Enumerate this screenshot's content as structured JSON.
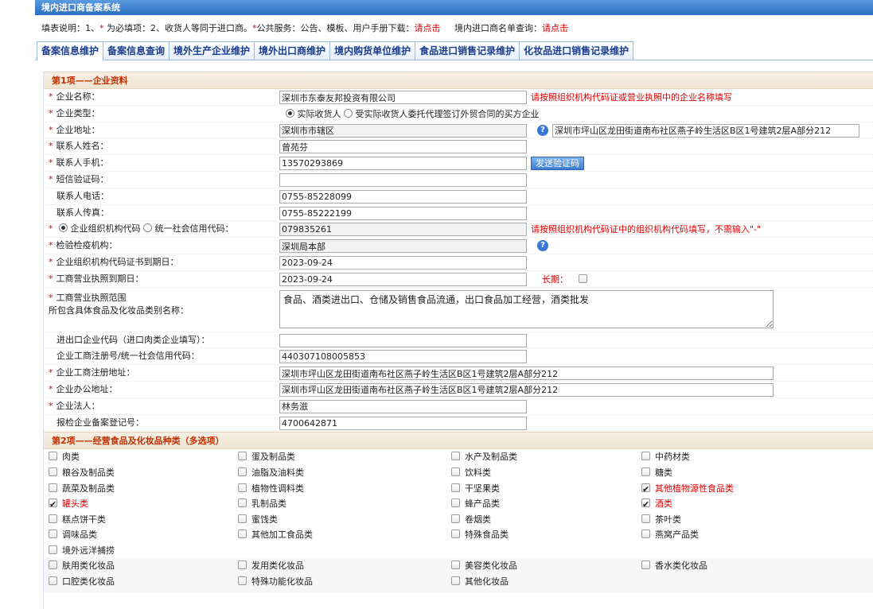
{
  "app": {
    "title": "境内进口商备案系统"
  },
  "notice": {
    "prefix": "填表说明：1、",
    "star": "*",
    "text1": " 为必填项：2、收货人等同于进口商。",
    "star2": "*",
    "text2": "公共服务：公告、模板、用户手册下载：",
    "link1": "请点击",
    "text3": "境内进口商名单查询：",
    "link2": "请点击"
  },
  "tabs": [
    "备案信息维护",
    "备案信息查询",
    "境外生产企业维护",
    "境外出口商维护",
    "境内购货单位维护",
    "食品进口销售记录维护",
    "化妆品进口销售记录维护"
  ],
  "section1": {
    "title": "第1项——企业资料"
  },
  "form": {
    "company_name": {
      "label": "企业名称：",
      "value": "深圳市东泰友邦投资有限公司",
      "hint": "请按照组织机构代码证或营业执照中的企业名称填写"
    },
    "company_type": {
      "label": "企业类型：",
      "opt1": "实际收货人",
      "opt2": "受实际收货人委托代理签订外贸合同的买方企业"
    },
    "address": {
      "label": "企业地址：",
      "district": "深圳市市辖区",
      "detail": "深圳市坪山区龙田街道南布社区燕子岭生活区B区1号建筑2层A部分212"
    },
    "contact_name": {
      "label": "联系人姓名：",
      "value": "曾苑芬"
    },
    "contact_mobile": {
      "label": "联系人手机：",
      "value": "13570293869",
      "button": "发送验证码"
    },
    "sms_code": {
      "label": "短信验证码：",
      "value": ""
    },
    "contact_phone": {
      "label": "联系人电话：",
      "value": "0755-85228099"
    },
    "contact_fax": {
      "label": "联系人传真：",
      "value": "0755-85222199"
    },
    "org_code": {
      "opt1": "企业组织机构代码",
      "opt2": "统一社会信用代码：",
      "value": "079835261",
      "hint": "请按照组织机构代码证中的组织机构代码填写，不需输入\"-\""
    },
    "inspection": {
      "label": "检验检疫机构：",
      "value": "深圳局本部"
    },
    "org_expiry": {
      "label": "企业组织机构代码证书到期日：",
      "value": "2023-09-24"
    },
    "license_expiry": {
      "label": "工商营业执照到期日：",
      "value": "2023-09-24",
      "long_term": "长期："
    },
    "scope": {
      "label1": "工商营业执照范围",
      "label2": "所包含具体食品及化妆品类别名称：",
      "value": "食品、酒类进出口、仓储及销售食品流通，出口食品加工经营，酒类批发"
    },
    "ie_code": {
      "label": "进出口企业代码（进口肉类企业填写）：",
      "value": ""
    },
    "reg_no": {
      "label": "企业工商注册号/统一社会信用代码：",
      "value": "440307108005853"
    },
    "reg_address": {
      "label": "企业工商注册地址：",
      "value": "深圳市坪山区龙田街道南布社区燕子岭生活区B区1号建筑2层A部分212"
    },
    "office_address": {
      "label": "企业办公地址：",
      "value": "深圳市坪山区龙田街道南布社区燕子岭生活区B区1号建筑2层A部分212"
    },
    "legal_person": {
      "label": "企业法人：",
      "value": "林务滋"
    },
    "filing_no": {
      "label": "报检企业备案登记号：",
      "value": "4700642871"
    }
  },
  "section2": {
    "title": "第2项——经营食品及化妆品种类（多选项）"
  },
  "categories": [
    {
      "label": "肉类",
      "checked": false
    },
    {
      "label": "蛋及制品类",
      "checked": false
    },
    {
      "label": "水产及制品类",
      "checked": false
    },
    {
      "label": "中药材类",
      "checked": false
    },
    {
      "label": "粮谷及制品类",
      "checked": false
    },
    {
      "label": "油脂及油料类",
      "checked": false
    },
    {
      "label": "饮料类",
      "checked": false
    },
    {
      "label": "糖类",
      "checked": false
    },
    {
      "label": "蔬菜及制品类",
      "checked": false
    },
    {
      "label": "植物性调料类",
      "checked": false
    },
    {
      "label": "干坚果类",
      "checked": false
    },
    {
      "label": "其他植物源性食品类",
      "checked": true
    },
    {
      "label": "罐头类",
      "checked": true
    },
    {
      "label": "乳制品类",
      "checked": false
    },
    {
      "label": "蜂产品类",
      "checked": false
    },
    {
      "label": "酒类",
      "checked": true
    },
    {
      "label": "糕点饼干类",
      "checked": false
    },
    {
      "label": "蜜饯类",
      "checked": false
    },
    {
      "label": "卷烟类",
      "checked": false
    },
    {
      "label": "茶叶类",
      "checked": false
    },
    {
      "label": "调味品类",
      "checked": false
    },
    {
      "label": "其他加工食品类",
      "checked": false
    },
    {
      "label": "特殊食品类",
      "checked": false
    },
    {
      "label": "燕窝产品类",
      "checked": false
    },
    {
      "label": "境外远洋捕捞",
      "checked": false
    }
  ],
  "cosmetics": [
    {
      "label": "肤用类化妆品",
      "checked": false
    },
    {
      "label": "发用类化妆品",
      "checked": false
    },
    {
      "label": "美容类化妆品",
      "checked": false
    },
    {
      "label": "香水类化妆品",
      "checked": false
    },
    {
      "label": "口腔类化妆品",
      "checked": false
    },
    {
      "label": "特殊功能化妆品",
      "checked": false
    },
    {
      "label": "其他化妆品",
      "checked": false
    }
  ]
}
